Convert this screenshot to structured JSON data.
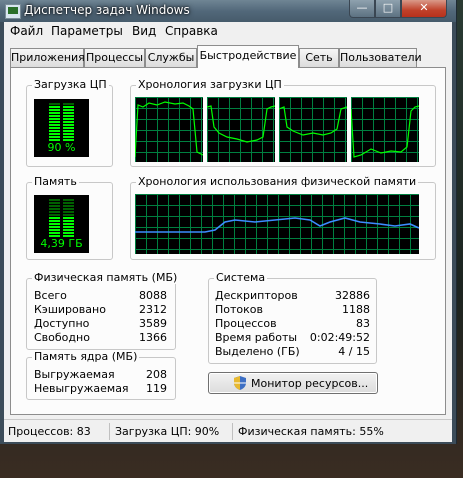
{
  "window": {
    "title": "Диспетчер задач Windows"
  },
  "menu": [
    "Файл",
    "Параметры",
    "Вид",
    "Справка"
  ],
  "tabs": [
    "Приложения",
    "Процессы",
    "Службы",
    "Быстродействие",
    "Сеть",
    "Пользователи"
  ],
  "active_tab": "Быстродействие",
  "cpu": {
    "label": "Загрузка ЦП",
    "value": "90 %",
    "level": 0.9
  },
  "cpu_history": {
    "label": "Хронология загрузки ЦП"
  },
  "memory": {
    "label": "Память",
    "value": "4,39 ГБ",
    "level": 0.55
  },
  "memory_history": {
    "label": "Хронология использования физической памяти"
  },
  "physical_memory": {
    "label": "Физическая память (МБ)",
    "rows": [
      {
        "name": "Всего",
        "value": "8088"
      },
      {
        "name": "Кэшировано",
        "value": "2312"
      },
      {
        "name": "Доступно",
        "value": "3589"
      },
      {
        "name": "Свободно",
        "value": "1366"
      }
    ]
  },
  "kernel_memory": {
    "label": "Память ядра (МБ)",
    "rows": [
      {
        "name": "Выгружаемая",
        "value": "208"
      },
      {
        "name": "Невыгружаемая",
        "value": "119"
      }
    ]
  },
  "system": {
    "label": "Система",
    "rows": [
      {
        "name": "Дескрипторов",
        "value": "32886"
      },
      {
        "name": "Потоков",
        "value": "1188"
      },
      {
        "name": "Процессов",
        "value": "83"
      },
      {
        "name": "Время работы",
        "value": "0:02:49:52"
      },
      {
        "name": "Выделено (ГБ)",
        "value": "4 / 15"
      }
    ]
  },
  "resource_monitor_button": "Монитор ресурсов...",
  "status": {
    "processes": "Процессов: 83",
    "cpu": "Загрузка ЦП: 90%",
    "memory": "Физическая память: 55%"
  },
  "colors": {
    "graph_bg": "#000000",
    "graph_grid": "#008040",
    "graph_line": "#00ff00",
    "memory_line": "#3c8cff"
  }
}
